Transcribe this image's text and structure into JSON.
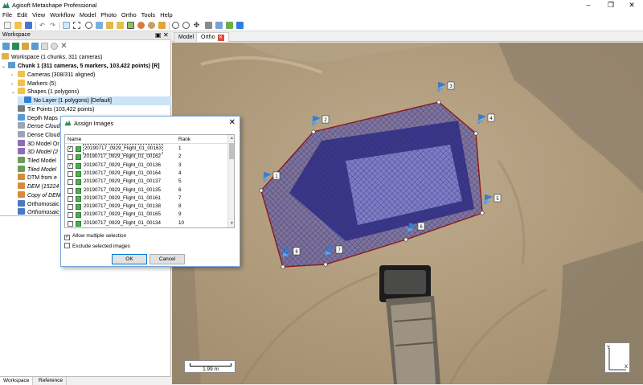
{
  "window": {
    "title": "Agisoft Metashape Professional",
    "controls": [
      "–",
      "❐",
      "✕"
    ]
  },
  "menu": [
    "File",
    "Edit",
    "View",
    "Workflow",
    "Model",
    "Photo",
    "Ortho",
    "Tools",
    "Help"
  ],
  "workspace": {
    "header": "Workspace",
    "root": "Workspace (1 chunks, 311 cameras)",
    "chunk": "Chunk 1 (311 cameras, 5 markers, 103,422 points) [R]",
    "items": [
      {
        "label": "Cameras (308/311 aligned)",
        "icon": "folder-icon",
        "indent": 2,
        "expander": "›"
      },
      {
        "label": "Markers (5)",
        "icon": "folder-icon",
        "indent": 2,
        "expander": "›"
      },
      {
        "label": "Shapes (1 polygons)",
        "icon": "folder-icon",
        "indent": 2,
        "expander": "⌄"
      },
      {
        "label": "No Layer (1 polygons) [Default]",
        "icon": "layer-icon",
        "indent": 3,
        "selected": true
      },
      {
        "label": "Tie Points (103,422 points)",
        "icon": "points-icon",
        "indent": 2
      },
      {
        "label": "Depth Maps",
        "icon": "depth-icon",
        "indent": 2
      },
      {
        "label": "Dense Cloud",
        "icon": "cloud-icon",
        "indent": 2,
        "italic": true
      },
      {
        "label": "Dense Cloud",
        "icon": "cloud-icon",
        "indent": 2
      },
      {
        "label": "3D Model Or",
        "icon": "model-icon",
        "indent": 2
      },
      {
        "label": "3D Model (2",
        "icon": "model-icon",
        "indent": 2,
        "italic": true
      },
      {
        "label": "Tiled Model",
        "icon": "tiled-icon",
        "indent": 2
      },
      {
        "label": "Tiled Model",
        "icon": "tiled-icon",
        "indent": 2,
        "italic": true
      },
      {
        "label": "DTM from e",
        "icon": "dem-icon",
        "indent": 2
      },
      {
        "label": "DEM (15224",
        "icon": "dem-icon",
        "indent": 2,
        "italic": true
      },
      {
        "label": "Copy of DEM",
        "icon": "dem-icon",
        "indent": 2,
        "italic": true
      },
      {
        "label": "Orthomosaic",
        "icon": "ortho-icon",
        "indent": 2
      },
      {
        "label": "Orthomosaic",
        "icon": "ortho-icon",
        "indent": 2,
        "italic": true
      }
    ]
  },
  "bottom_tabs": [
    "Workspace",
    "Reference"
  ],
  "view_tabs": {
    "model": "Model",
    "ortho": "Ortho",
    "ortho_close": "✕"
  },
  "scalebar": {
    "label": "1.99 m"
  },
  "axes": {
    "y": "Y",
    "x": "X"
  },
  "dialog": {
    "title": "Assign Images",
    "close": "✕",
    "col_name": "Name",
    "col_rank": "Rank",
    "rows": [
      {
        "name": "20190717_0929_Flight_01_00163",
        "rank": "1",
        "checked": true,
        "focus": true
      },
      {
        "name": "20190717_0929_Flight_01_00162",
        "rank": "2",
        "checked": false
      },
      {
        "name": "20190717_0929_Flight_01_00136",
        "rank": "3",
        "checked": true
      },
      {
        "name": "20190717_0929_Flight_01_00164",
        "rank": "4",
        "checked": false
      },
      {
        "name": "20190717_0929_Flight_01_00137",
        "rank": "5",
        "checked": false
      },
      {
        "name": "20190717_0929_Flight_01_00135",
        "rank": "6",
        "checked": false
      },
      {
        "name": "20190717_0929_Flight_01_00161",
        "rank": "7",
        "checked": false
      },
      {
        "name": "20190717_0929_Flight_01_00138",
        "rank": "8",
        "checked": false
      },
      {
        "name": "20190717_0929_Flight_01_00165",
        "rank": "9",
        "checked": false
      },
      {
        "name": "20190717_0929_Flight_01_00134",
        "rank": "10",
        "checked": false
      }
    ],
    "allow_multiple": {
      "label": "Allow multiple selection",
      "checked": true
    },
    "exclude_selected": {
      "label": "Exclude selected images",
      "checked": false
    },
    "ok": "OK",
    "cancel": "Cancel"
  },
  "markers": [
    "1",
    "2",
    "3",
    "4",
    "5",
    "6",
    "7",
    "8"
  ],
  "colors": {
    "polygon_fill": "#3a3aa8",
    "polygon_edge": "#8b1a1a",
    "marker": "#2f7fd8",
    "selection": "#cce4f7",
    "ground": "#b39d7f"
  }
}
